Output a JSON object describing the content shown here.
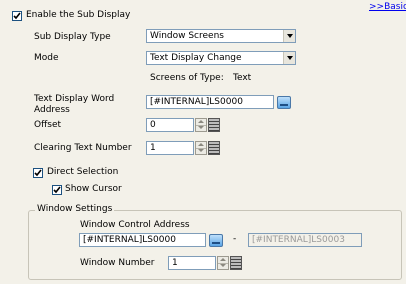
{
  "nav": {
    "basic_link": ">>Basic"
  },
  "enable_sub_display": {
    "label": "Enable the Sub Display",
    "checked": true
  },
  "sub_display_type": {
    "label": "Sub Display Type",
    "value": "Window Screens"
  },
  "mode": {
    "label": "Mode",
    "value": "Text Display Change"
  },
  "screens_of_type": {
    "label": "Screens of Type:",
    "value": "Text"
  },
  "text_display_word_address": {
    "label_line1": "Text Display Word",
    "label_line2": "Address",
    "value": "[#INTERNAL]LS0000"
  },
  "offset": {
    "label": "Offset",
    "value": "0"
  },
  "clearing_text_number": {
    "label": "Clearing Text Number",
    "value": "1"
  },
  "direct_selection": {
    "label": "Direct Selection",
    "checked": true
  },
  "show_cursor": {
    "label": "Show Cursor",
    "checked": true
  },
  "window_settings": {
    "title": "Window Settings",
    "control_address_label": "Window Control Address",
    "control_address_value": "[#INTERNAL]LS0000",
    "separator": "-",
    "control_address_end_value": "[#INTERNAL]LS0003",
    "window_number_label": "Window Number",
    "window_number_value": "1"
  }
}
